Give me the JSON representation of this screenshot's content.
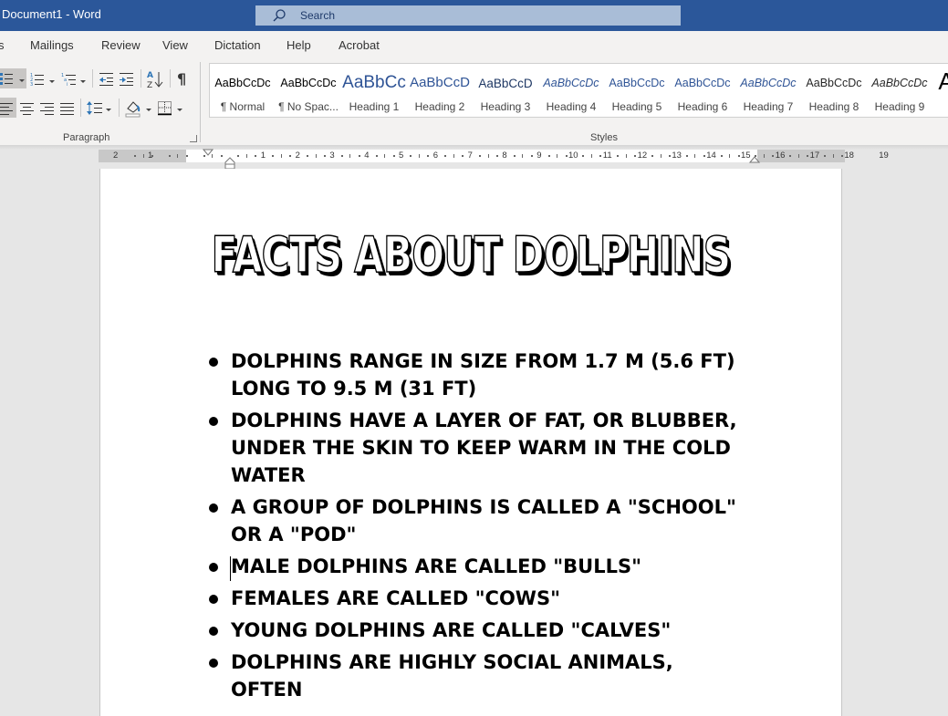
{
  "window": {
    "title": "Document1  -  Word",
    "search_placeholder": "Search"
  },
  "ribbon_tabs": [
    "s",
    "Mailings",
    "Review",
    "View",
    "Dictation",
    "Help",
    "Acrobat"
  ],
  "paragraph_group": {
    "label": "Paragraph",
    "buttons": {
      "bullets": "bullets-icon",
      "numbering": "numbering-icon",
      "multilevel": "multilevel-list-icon",
      "decrease_indent": "decrease-indent-icon",
      "increase_indent": "increase-indent-icon",
      "sort": "sort-icon",
      "show_marks": "pilcrow-icon",
      "align_left": "align-left-icon",
      "center": "align-center-icon",
      "align_right": "align-right-icon",
      "justify": "justify-icon",
      "line_spacing": "line-spacing-icon",
      "shading": "shading-icon",
      "borders": "borders-icon"
    },
    "selected": [
      "bullets",
      "align_left"
    ]
  },
  "styles_group": {
    "label": "Styles",
    "items": [
      {
        "preview": "AaBbCcDc",
        "name": "¶ Normal"
      },
      {
        "preview": "AaBbCcDc",
        "name": "¶ No Spac..."
      },
      {
        "preview": "AaBbCc",
        "name": "Heading 1"
      },
      {
        "preview": "AaBbCcD",
        "name": "Heading 2"
      },
      {
        "preview": "AaBbCcD",
        "name": "Heading 3"
      },
      {
        "preview": "AaBbCcDc",
        "name": "Heading 4"
      },
      {
        "preview": "AaBbCcDc",
        "name": "Heading 5"
      },
      {
        "preview": "AaBbCcDc",
        "name": "Heading 6"
      },
      {
        "preview": "AaBbCcDc",
        "name": "Heading 7"
      },
      {
        "preview": "AaBbCcDc",
        "name": "Heading 8"
      },
      {
        "preview": "AaBbCcDc",
        "name": "Heading 9"
      },
      {
        "preview": "A",
        "name": ""
      }
    ]
  },
  "ruler": {
    "left_numbers": [
      "2",
      "1"
    ],
    "numbers": [
      "1",
      "2",
      "3",
      "4",
      "5",
      "6",
      "7",
      "8",
      "9",
      "10",
      "11",
      "12",
      "13",
      "14",
      "15",
      "16",
      "17",
      "18",
      "19"
    ]
  },
  "document": {
    "heading": "FACTS ABOUT DOLPHINS",
    "bullets": [
      "DOLPHINS RANGE IN SIZE FROM 1.7 M (5.6 FT) LONG TO 9.5 M (31 FT)",
      "DOLPHINS HAVE A LAYER OF FAT, OR BLUBBER, UNDER THE SKIN TO KEEP WARM IN THE COLD WATER",
      "A GROUP OF DOLPHINS IS CALLED A \"SCHOOL\" OR A \"POD\"",
      "MALE DOLPHINS ARE CALLED \"BULLS\"",
      "FEMALES ARE CALLED \"COWS\"",
      "YOUNG DOLPHINS ARE CALLED \"CALVES\"",
      "DOLPHINS ARE HIGHLY SOCIAL ANIMALS, OFTEN"
    ]
  },
  "colors": {
    "titlebar": "#2b579a",
    "search": "#a9bdd7",
    "accent_blue": "#2e75b6"
  }
}
